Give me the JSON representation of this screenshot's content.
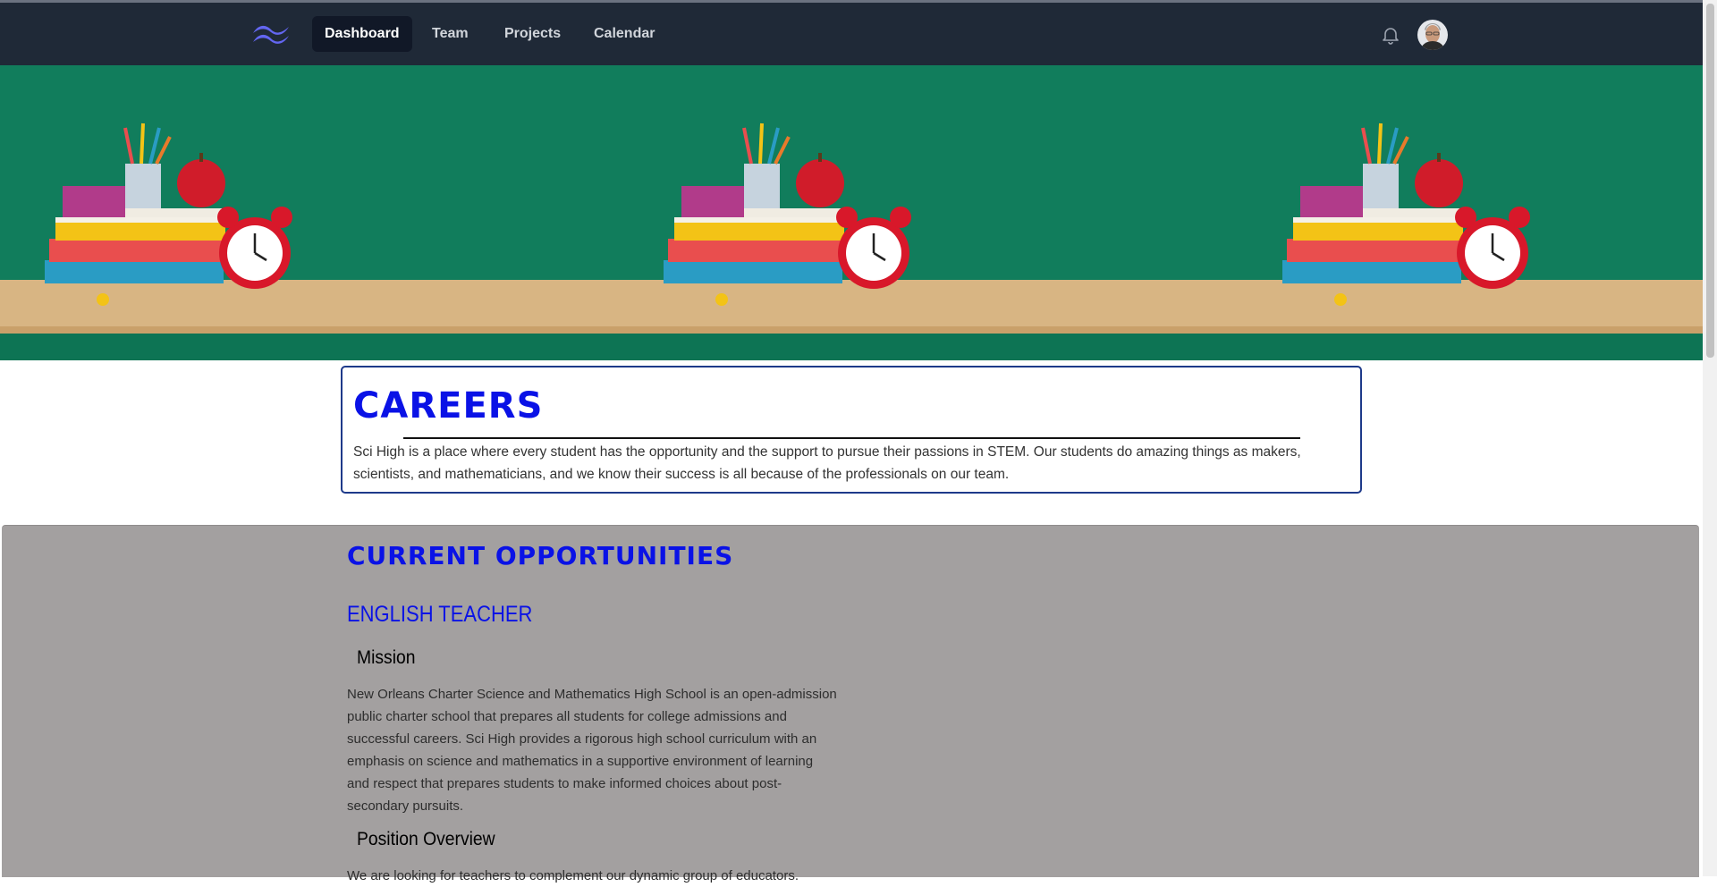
{
  "nav": {
    "items": [
      {
        "label": "Dashboard",
        "active": true
      },
      {
        "label": "Team",
        "active": false
      },
      {
        "label": "Projects",
        "active": false
      },
      {
        "label": "Calendar",
        "active": false
      }
    ],
    "icons": {
      "logo": "tailwind-logo",
      "notifications": "bell-icon",
      "avatar": "user-avatar"
    }
  },
  "careers": {
    "title": "CAREERS",
    "text": "Sci High is a place where every student has the opportunity and the support to pursue their passions in STEM. Our students do amazing things as makers, scientists, and mathematicians, and we know their success is all because of the professionals on our team."
  },
  "opportunities": {
    "title": "CURRENT OPPORTUNITIES",
    "job": {
      "title": "ENGLISH TEACHER",
      "mission_heading": "Mission",
      "mission_text": "New Orleans Charter Science and Mathematics High School is an open-admission public charter school that prepares all students for college admissions and successful careers. Sci High provides a rigorous high school curriculum with an emphasis on science and mathematics in a supportive environment of learning and respect that prepares students to make informed choices about post-secondary pursuits.",
      "overview_heading": "Position Overview",
      "overview_text": "We are looking for teachers to complement our dynamic group of educators."
    }
  },
  "colors": {
    "nav_bg": "#1f2937",
    "accent_blue": "#0a12e6",
    "section_gray": "#a3a0a0",
    "box_border": "#1e3a8a"
  }
}
